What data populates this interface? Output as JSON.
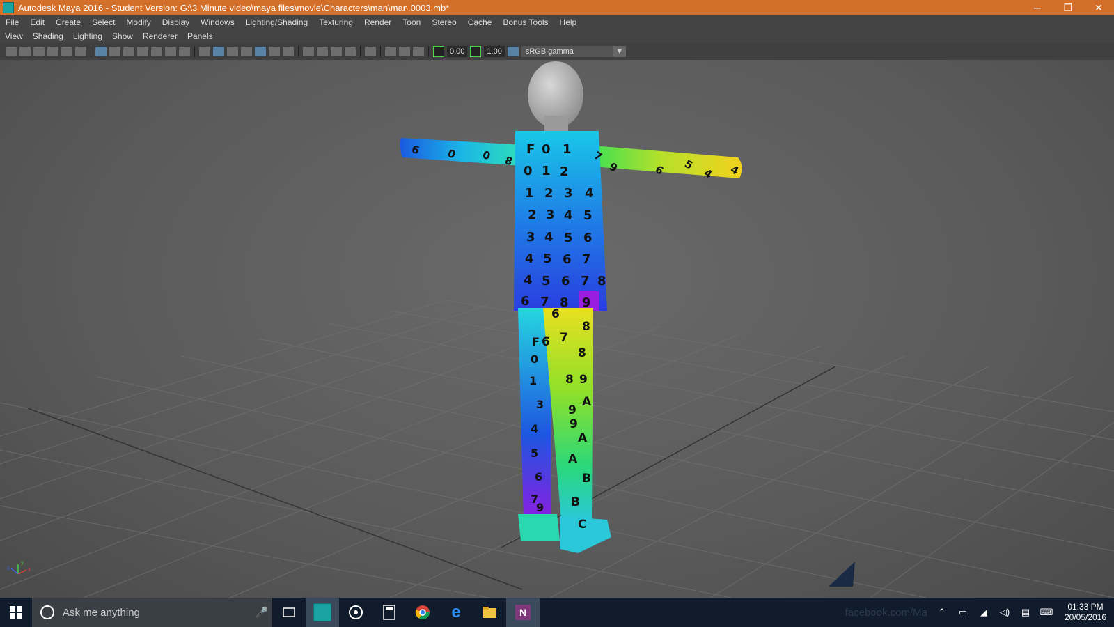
{
  "window": {
    "title": "Autodesk Maya 2016 - Student Version: G:\\3 Minute video\\maya files\\movie\\Characters\\man\\man.0003.mb*",
    "minimize": "─",
    "restore": "❐",
    "close": "✕"
  },
  "menubar": [
    "File",
    "Edit",
    "Create",
    "Select",
    "Modify",
    "Display",
    "Windows",
    "Lighting/Shading",
    "Texturing",
    "Render",
    "Toon",
    "Stereo",
    "Cache",
    "Bonus Tools",
    "Help"
  ],
  "panel_menu": [
    "View",
    "Shading",
    "Lighting",
    "Show",
    "Renderer",
    "Panels"
  ],
  "toolbar": {
    "exposure": "0.00",
    "gamma_value": "1.00",
    "color_space": "sRGB gamma"
  },
  "viewport": {
    "uv_labels_torso": [
      "F",
      "0",
      "1",
      "0",
      "1",
      "2",
      "1",
      "2",
      "3",
      "4",
      "2",
      "3",
      "4",
      "5",
      "3",
      "4",
      "5",
      "6",
      "4",
      "5",
      "6",
      "7",
      "4",
      "5",
      "6",
      "7",
      "8",
      "6",
      "7",
      "8",
      "9"
    ],
    "uv_labels_left_arm": [
      "6",
      "0",
      "0",
      "8"
    ],
    "uv_labels_right_arm": [
      "7",
      "9",
      "6",
      "5",
      "4",
      "4"
    ],
    "uv_labels_left_leg": [
      "F",
      "0",
      "1",
      "3",
      "4",
      "5",
      "6",
      "7",
      "9"
    ],
    "uv_labels_right_leg": [
      "6",
      "8",
      "6",
      "7",
      "8",
      "8",
      "9",
      "9",
      "A",
      "9",
      "A",
      "A",
      "B",
      "B",
      "C"
    ],
    "axis_labels": [
      "y",
      "x",
      "z"
    ]
  },
  "taskbar": {
    "search_placeholder": "Ask me anything",
    "watermark": "facebook.com/Ma",
    "time": "01:33 PM",
    "date": "20/05/2016",
    "icons": [
      "start-icon",
      "task-view-icon",
      "maya-icon",
      "media-player-icon",
      "calculator-icon",
      "chrome-icon",
      "edge-icon",
      "file-explorer-icon",
      "onenote-icon"
    ]
  }
}
